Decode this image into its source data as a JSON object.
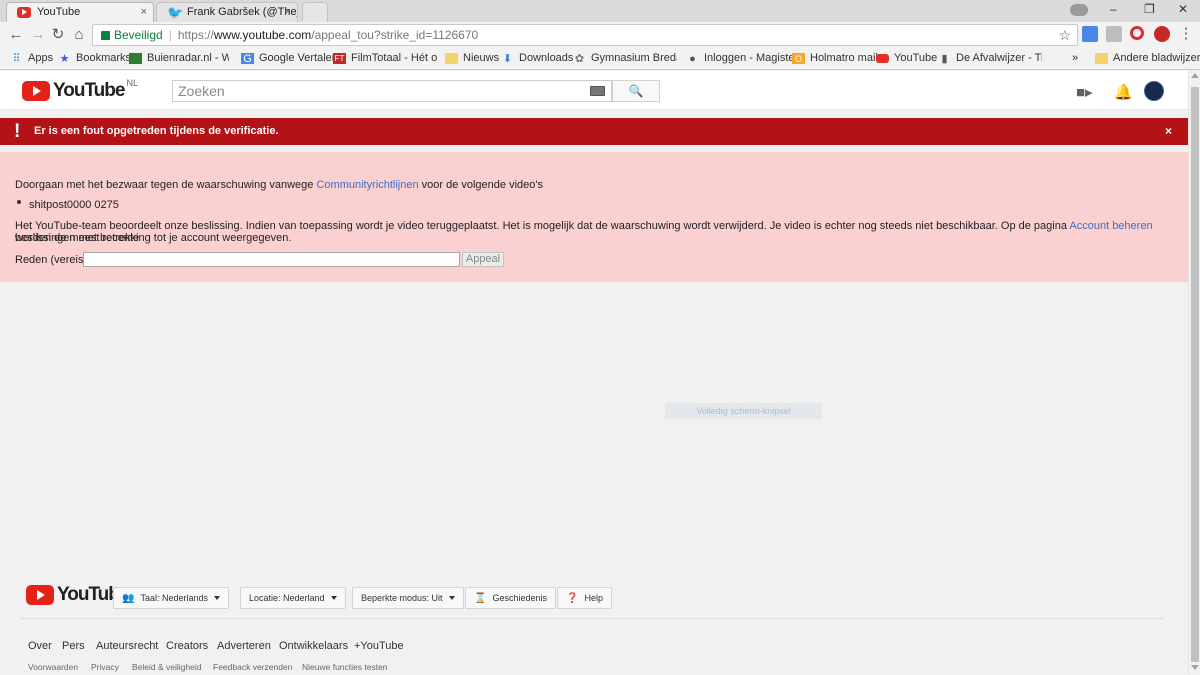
{
  "browser": {
    "tabs": [
      {
        "title": "YouTube",
        "favicon": "youtube-favicon",
        "active": true
      },
      {
        "title": "Frank Gabršek (@The_Fre",
        "favicon": "twitter-favicon",
        "active": false
      }
    ],
    "tab_close": "×",
    "window_controls": {
      "minimize": "–",
      "restore": "❐",
      "close": "✕"
    },
    "nav": {
      "back": "←",
      "forward": "→",
      "reload": "↻",
      "home": "⌂"
    },
    "secure_label": "Beveiligd",
    "url_scheme": "https://",
    "url_host": "www.youtube.com",
    "url_path": "/appeal_tou?strike_id=1126670",
    "bookmark_star": "☆",
    "bookmarks": [
      {
        "label": "Apps",
        "icon": "apps-grid-icon"
      },
      {
        "label": "Bookmarks",
        "icon": "star-icon"
      },
      {
        "label": "Buienradar.nl - Weer",
        "icon": "weather-icon"
      },
      {
        "label": "Google Vertalen",
        "icon": "translate-icon"
      },
      {
        "label": "FilmTotaal - Hét onlir",
        "icon": "filmtotaal-icon"
      },
      {
        "label": "Nieuws",
        "icon": "folder-icon"
      },
      {
        "label": "Downloads",
        "icon": "download-icon"
      },
      {
        "label": "Gymnasium Breda Ho",
        "icon": "school-icon"
      },
      {
        "label": "Inloggen - Magister",
        "icon": "magister-icon"
      },
      {
        "label": "Holmatro mail",
        "icon": "mail-icon"
      },
      {
        "label": "YouTube",
        "icon": "youtube-icon"
      },
      {
        "label": "De Afvalwijzer - Tijge",
        "icon": "trash-icon"
      }
    ],
    "bookmarks_overflow": "»",
    "other_bookmarks": "Andere bladwijzers"
  },
  "header": {
    "logo_text": "YouTube",
    "country_code": "NL",
    "search_placeholder": "Zoeken",
    "search_icon": "🔍"
  },
  "error": {
    "icon": "!",
    "message": "Er is een fout opgetreden tijdens de verificatie.",
    "close": "×"
  },
  "appeal": {
    "intro_before": "Doorgaan met het bezwaar tegen de waarschuwing vanwege ",
    "intro_link": "Communityrichtlijnen",
    "intro_after": " voor de volgende video's",
    "video_title": "shitpost0000 0275",
    "info_line1_before": "Het YouTube-team beoordeelt onze beslissing. Indien van toepassing wordt je video teruggeplaatst. Het is mogelijk dat de waarschuwing wordt verwijderd. Je video is echter nog steeds niet beschikbaar. Op de pagina ",
    "info_link": "Account beheren",
    "info_line1_after": " worden de meest recente",
    "info_line2": "beslissingen met betrekking tot je account weergegeven.",
    "reason_label": "Reden (vereist)",
    "reason_value": "",
    "appeal_button": "Appeal"
  },
  "overlay": {
    "snip_text": "Volledig scherm-knipsel"
  },
  "footer": {
    "logo_text": "YouTube",
    "language_button": "Taal: Nederlands",
    "location_button": "Locatie: Nederland",
    "restricted_button": "Beperkte modus: Uit",
    "history_button": "Geschiedenis",
    "help_button": "Help",
    "links": [
      "Over",
      "Pers",
      "Auteursrecht",
      "Creators",
      "Adverteren",
      "Ontwikkelaars",
      "+YouTube"
    ],
    "small_links": [
      "Voorwaarden",
      "Privacy",
      "Beleid & veiligheid",
      "Feedback verzenden",
      "Nieuwe functies testen"
    ]
  },
  "colors": {
    "error_red": "#b31217",
    "panel_pink": "#fbd0d0",
    "link_blue": "#3f6ec6",
    "youtube_red": "#e62117"
  }
}
